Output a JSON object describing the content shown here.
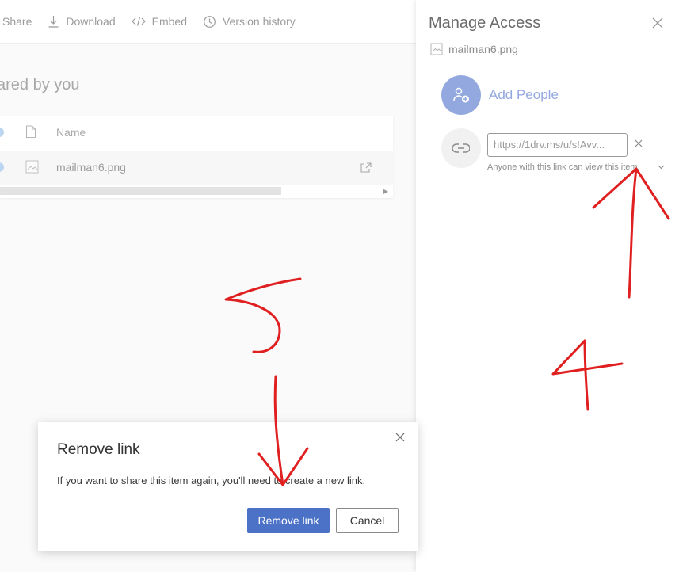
{
  "toolbar": {
    "share_label": "Share",
    "download_label": "Download",
    "embed_label": "Embed",
    "version_history_label": "Version history"
  },
  "main": {
    "heading": "ared by you",
    "table": {
      "column_name": "Name",
      "rows": [
        {
          "name": "mailman6.png"
        }
      ]
    }
  },
  "manage_access": {
    "title": "Manage Access",
    "file_name": "mailman6.png",
    "add_people_label": "Add People",
    "link": {
      "url": "https://1drv.ms/u/s!Avv...",
      "note": "Anyone with this link can view this item."
    }
  },
  "dialog": {
    "title": "Remove link",
    "body": "If you want to share this item again, you'll need to create a new link.",
    "primary_label": "Remove link",
    "secondary_label": "Cancel"
  },
  "annotations": {
    "marks": [
      "5",
      "4"
    ],
    "color": "#e02020"
  },
  "colors": {
    "accent": "#4b72c7",
    "add_people": "#93a8df"
  },
  "icons": [
    "share-icon",
    "download-icon",
    "embed-icon",
    "history-icon",
    "file-icon",
    "image-file-icon",
    "close-icon",
    "add-people-icon",
    "link-icon",
    "chevron-down-icon"
  ]
}
